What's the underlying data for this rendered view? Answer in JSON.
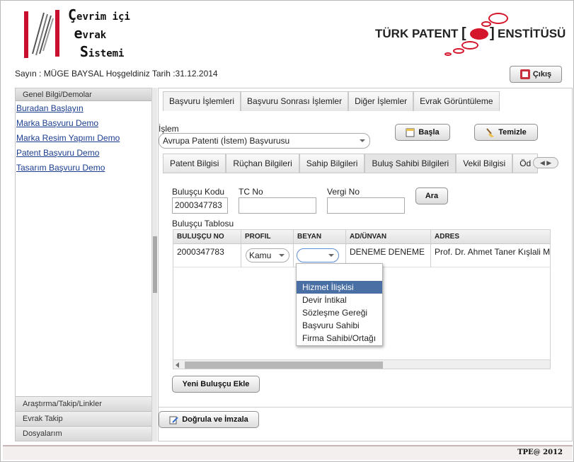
{
  "header": {
    "logo_left": {
      "line1_big": "Ç",
      "line1": "evrim içi",
      "line2_big": "e",
      "line2": "vrak",
      "line3_big": "S",
      "line3": "istemi"
    },
    "logo_right": {
      "text_before": "TÜRK PATENT",
      "text_after": "ENSTİTÜSÜ"
    }
  },
  "welcome_text": "Sayın : MÜGE BAYSAL Hoşgeldiniz Tarih :31.12.2014",
  "logout_label": "Çıkış",
  "sidebar": {
    "header": "Genel Bilgi/Demolar",
    "links": [
      "Buradan Başlayın",
      "Marka Başvuru Demo",
      "Marka Resim Yapımı Demo",
      "Patent Başvuru Demo",
      "Tasarım Başvuru Demo"
    ],
    "bottom_sections": [
      "Araştırma/Takip/Linkler",
      "Evrak Takip",
      "Dosyalarım"
    ]
  },
  "top_tabs": [
    "Başvuru İşlemleri",
    "Başvuru Sonrası İşlemler",
    "Diğer İşlemler",
    "Evrak Görüntüleme"
  ],
  "islem": {
    "label": "İşlem",
    "value": "Avrupa Patenti (İstem) Başvurusu"
  },
  "buttons": {
    "basla": "Başla",
    "temizle": "Temizle",
    "ara": "Ara",
    "yeni_bulucu": "Yeni Buluşçu Ekle",
    "dogrula": "Doğrula ve İmzala"
  },
  "sub_tabs": [
    "Patent Bilgisi",
    "Rüçhan Bilgileri",
    "Sahip Bilgileri",
    "Buluş Sahibi Bilgileri",
    "Vekil Bilgisi",
    "Öd"
  ],
  "search_fields": {
    "bulucu_kodu": {
      "label": "Buluşçu Kodu",
      "value": "2000347783"
    },
    "tc_no": {
      "label": "TC No",
      "value": ""
    },
    "vergi_no": {
      "label": "Vergi No",
      "value": ""
    }
  },
  "table": {
    "title": "Buluşçu Tablosu",
    "columns": [
      "BULUŞÇU NO",
      "PROFIL",
      "BEYAN",
      "AD/ÜNVAN",
      "ADRES"
    ],
    "row": {
      "bulucu_no": "2000347783",
      "profil": "Kamu",
      "beyan": "",
      "ad_unvan": "DENEME DENEME",
      "adres": "Prof. Dr. Ahmet Taner Kışlali M"
    }
  },
  "beyan_dropdown": {
    "options": [
      "",
      "Hizmet İlişkisi",
      "Devir İntikal",
      "Sözleşme Gereği",
      "Başvuru Sahibi",
      "Firma Sahibi/Ortağı"
    ],
    "highlighted": "Hizmet İlişkisi"
  },
  "footer": "TPE@ 2012",
  "colors": {
    "accent_red": "#d4152b",
    "link_blue": "#1a3d8f",
    "dropdown_highlight": "#4a6fa5"
  }
}
